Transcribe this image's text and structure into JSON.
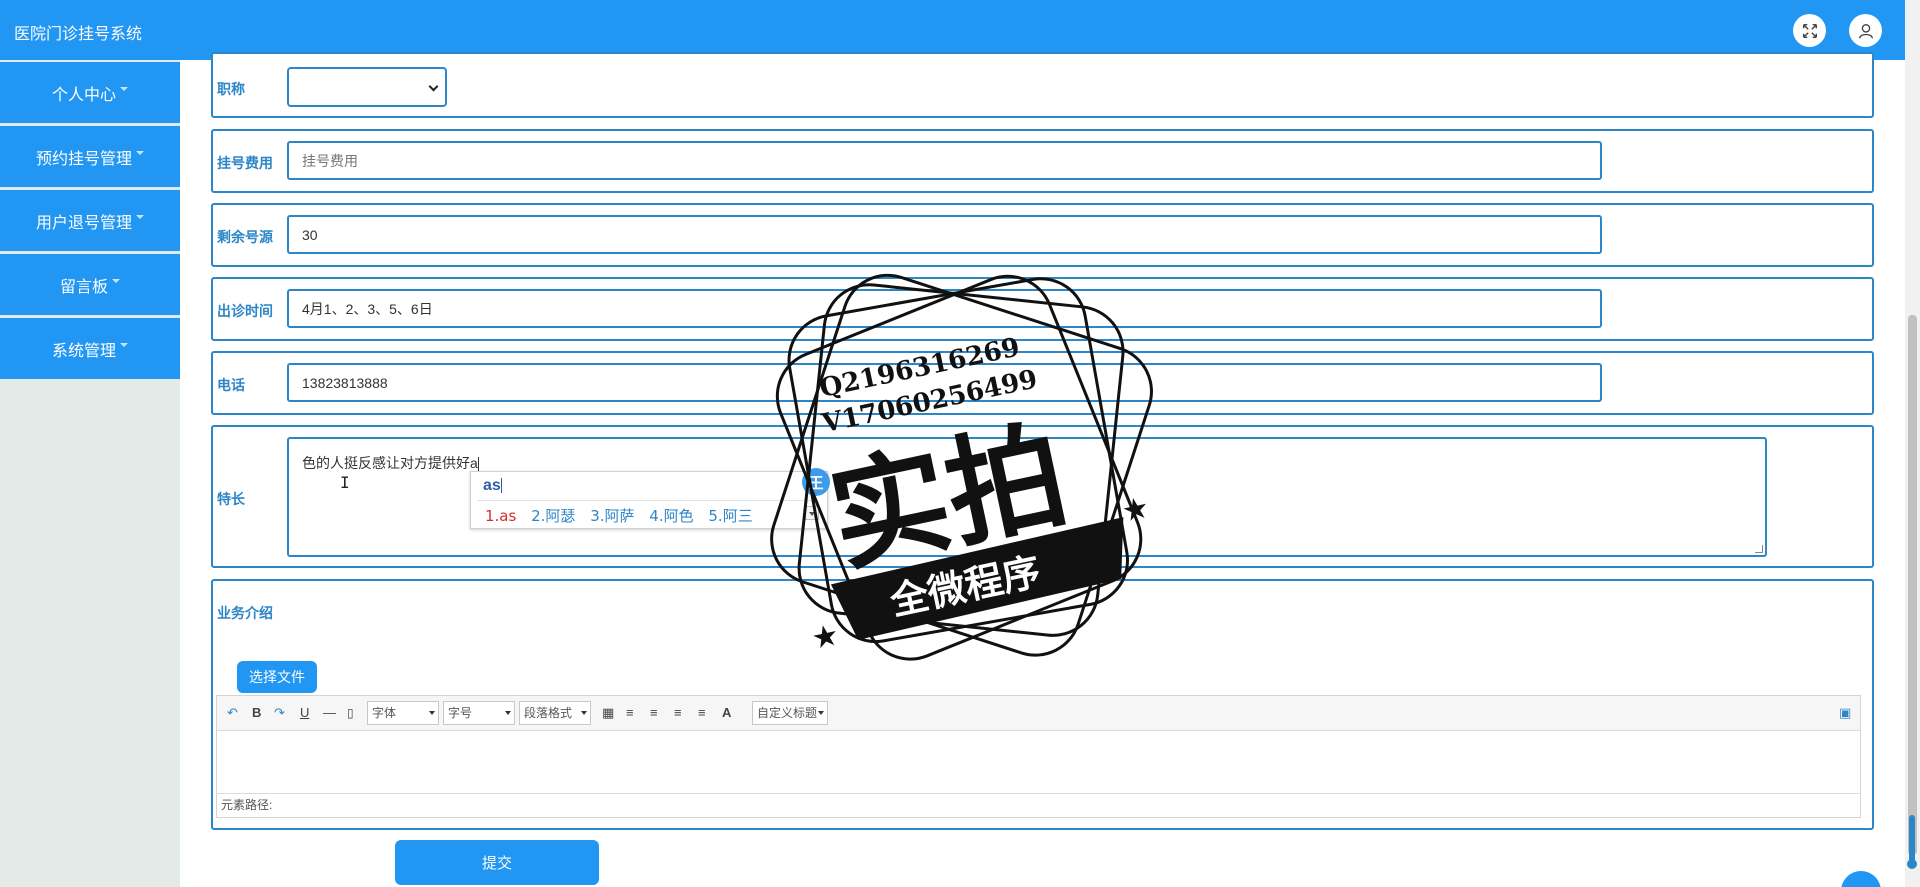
{
  "app": {
    "title": "医院门诊挂号系统"
  },
  "header": {
    "fullscreen_icon": "fullscreen-icon",
    "user_icon": "user-icon"
  },
  "sidebar": {
    "items": [
      {
        "label": "个人中心"
      },
      {
        "label": "预约挂号管理"
      },
      {
        "label": "用户退号管理"
      },
      {
        "label": "留言板"
      },
      {
        "label": "系统管理"
      }
    ]
  },
  "form": {
    "title_field": {
      "label": "职称",
      "value": ""
    },
    "fee": {
      "label": "挂号费用",
      "placeholder": "挂号费用",
      "value": ""
    },
    "remaining": {
      "label": "剩余号源",
      "value": "30"
    },
    "schedule": {
      "label": "出诊时间",
      "value": "4月1、2、3、5、6日"
    },
    "phone": {
      "label": "电话",
      "value": "13823813888"
    },
    "specialty": {
      "label": "特长",
      "value": "色的人挺反感让对方提供好a"
    },
    "business": {
      "label": "业务介绍"
    },
    "submit_label": "提交"
  },
  "ime": {
    "input": "as",
    "badge": "王",
    "candidates": [
      "1.as",
      "2.阿瑟",
      "3.阿萨",
      "4.阿色",
      "5.阿三"
    ]
  },
  "editor": {
    "file_button": "选择文件",
    "font_select": "字体",
    "size_select": "字号",
    "paragraph_select": "段落格式",
    "custom_title_select": "自定义标题",
    "footer_path": "元素路径:",
    "font_color_label": "A"
  },
  "watermark": {
    "line1": "Q2196316269",
    "line2": "V17060256499",
    "main": "实拍",
    "banner": "全微程序"
  },
  "colors": {
    "primary": "#2196f3",
    "border": "#2d86c8",
    "sidebar_bg": "#e3ebe8"
  }
}
